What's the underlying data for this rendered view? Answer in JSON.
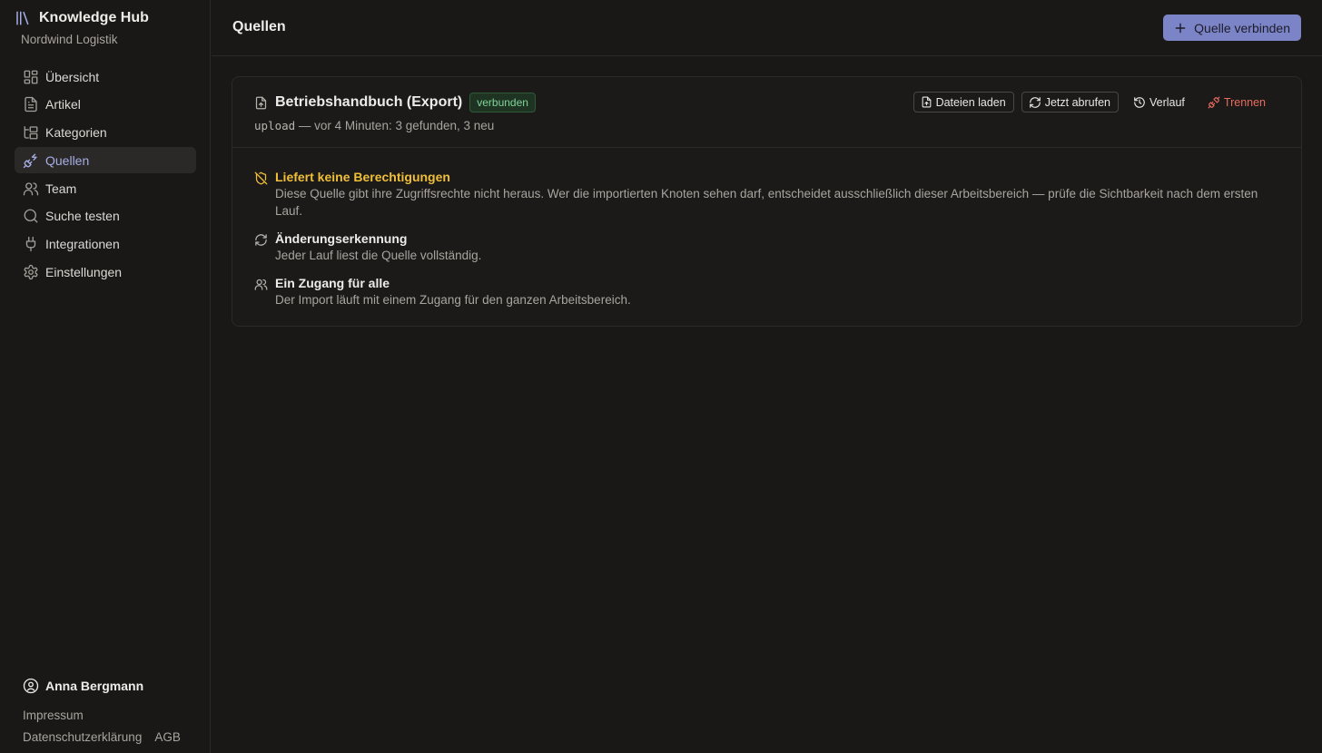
{
  "app": {
    "name": "Knowledge Hub",
    "org": "Nordwind Logistik"
  },
  "nav": [
    {
      "label": "Übersicht",
      "icon": "dashboard-icon"
    },
    {
      "label": "Artikel",
      "icon": "file-text-icon"
    },
    {
      "label": "Kategorien",
      "icon": "folder-tree-icon"
    },
    {
      "label": "Quellen",
      "icon": "plug-zap-icon",
      "active": true
    },
    {
      "label": "Team",
      "icon": "users-icon"
    },
    {
      "label": "Suche testen",
      "icon": "search-icon"
    },
    {
      "label": "Integrationen",
      "icon": "plug-icon"
    },
    {
      "label": "Einstellungen",
      "icon": "settings-icon"
    }
  ],
  "user": {
    "name": "Anna Bergmann"
  },
  "legal": {
    "imprint": "Impressum",
    "privacy": "Datenschutzerklärung",
    "terms": "AGB"
  },
  "header": {
    "title": "Quellen",
    "connect_label": "Quelle verbinden"
  },
  "source": {
    "title": "Betriebshandbuch (Export)",
    "status": "verbunden",
    "type": "upload",
    "summary": " — vor 4 Minuten: 3 gefunden, 3 neu",
    "actions": {
      "upload": "Dateien laden",
      "fetch": "Jetzt abrufen",
      "history": "Verlauf",
      "disconnect": "Trennen"
    },
    "notes": [
      {
        "title": "Liefert keine Berechtigungen",
        "body": "Diese Quelle gibt ihre Zugriffsrechte nicht heraus. Wer die importierten Knoten sehen darf, entscheidet ausschließlich dieser Arbeitsbereich — prüfe die Sichtbarkeit nach dem ersten Lauf."
      },
      {
        "title": "Änderungserkennung",
        "body": "Jeder Lauf liest die Quelle vollständig."
      },
      {
        "title": "Ein Zugang für alle",
        "body": "Der Import läuft mit einem Zugang für den ganzen Arbeitsbereich."
      }
    ]
  },
  "colors": {
    "accent": "#7c84c8",
    "active_text": "#a6aee6",
    "warning": "#f0bf3a",
    "success": "#7fd49a",
    "danger": "#e86b5f"
  }
}
